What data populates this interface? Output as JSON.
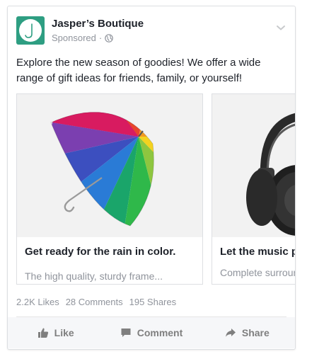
{
  "post": {
    "page_name": "Jasper’s Boutique",
    "sponsored_label": "Sponsored",
    "separator": "·",
    "caption": "Explore the new season of goodies! We offer a wide range of gift ideas for friends, family, or yourself!",
    "logo_color": "#2e9e82"
  },
  "carousel": {
    "cards": [
      {
        "image_icon": "umbrella",
        "title": "Get ready for the rain in color.",
        "description": "The high quality, sturdy frame..."
      },
      {
        "image_icon": "headphones",
        "title": "Let the music play loud and clear.",
        "description": "Complete surround sound"
      }
    ]
  },
  "stats": {
    "likes": "2.2K Likes",
    "comments": "28 Comments",
    "shares": "195 Shares"
  },
  "actions": {
    "like": "Like",
    "comment": "Comment",
    "share": "Share"
  }
}
